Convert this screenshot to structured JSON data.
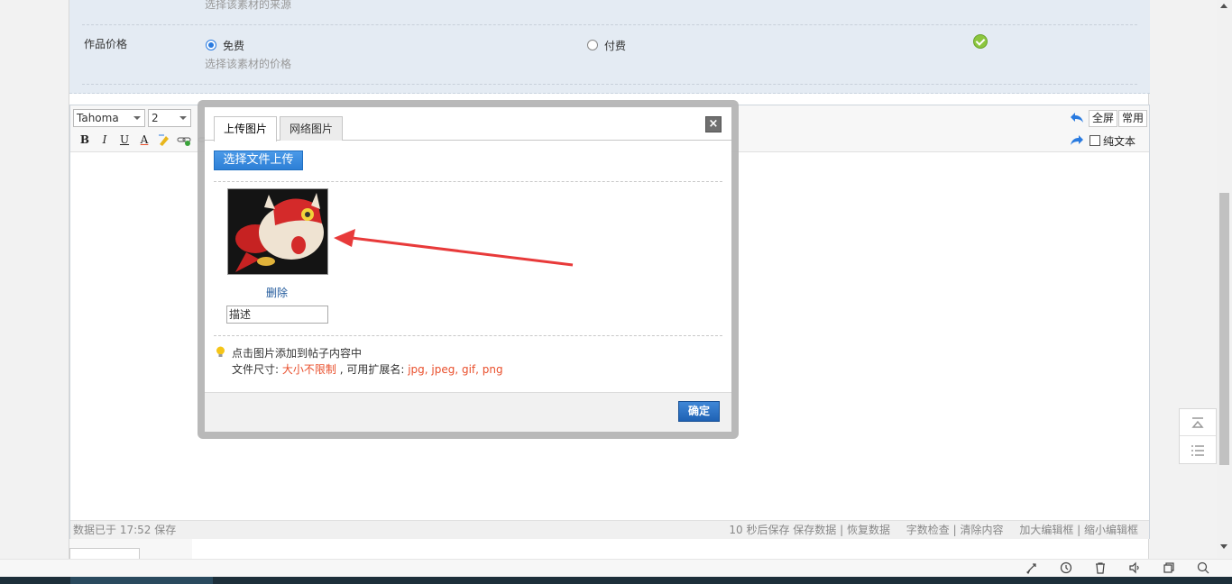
{
  "form": {
    "source_hint": "选择该素材的来源",
    "price_label": "作品价格",
    "option_free": "免费",
    "option_paid": "付费",
    "price_hint": "选择该素材的价格",
    "selected_option": "免费"
  },
  "editor": {
    "font_family": "Tahoma",
    "font_size": "2",
    "fullscreen_label": "全屏",
    "common_label": "常用",
    "plain_text_label": "纯文本",
    "bold": "B",
    "italic": "I",
    "underline": "U",
    "font_color": "A",
    "status_saved": "数据已于 17:52 保存",
    "status_autosave": "10 秒后保存 保存数据 | 恢复数据",
    "status_wordcheck": "字数检查 | 清除内容",
    "status_resize": "加大编辑框 | 缩小编辑框"
  },
  "dialog": {
    "tab_upload": "上传图片",
    "tab_web": "网络图片",
    "close_label": "×",
    "upload_button": "选择文件上传",
    "delete_link": "删除",
    "desc_value": "描述",
    "tip_click": "点击图片添加到帖子内容中",
    "size_prefix": "文件尺寸: ",
    "size_value": "大小不限制",
    "ext_prefix": " , 可用扩展名: ",
    "ext_value": "jpg, jpeg, gif, png",
    "confirm_button": "确定"
  },
  "colors": {
    "accent_blue": "#2a7be0",
    "red_text": "#e94f2c",
    "success_green": "#8cc63e",
    "arrow_red": "#e83a3a"
  }
}
